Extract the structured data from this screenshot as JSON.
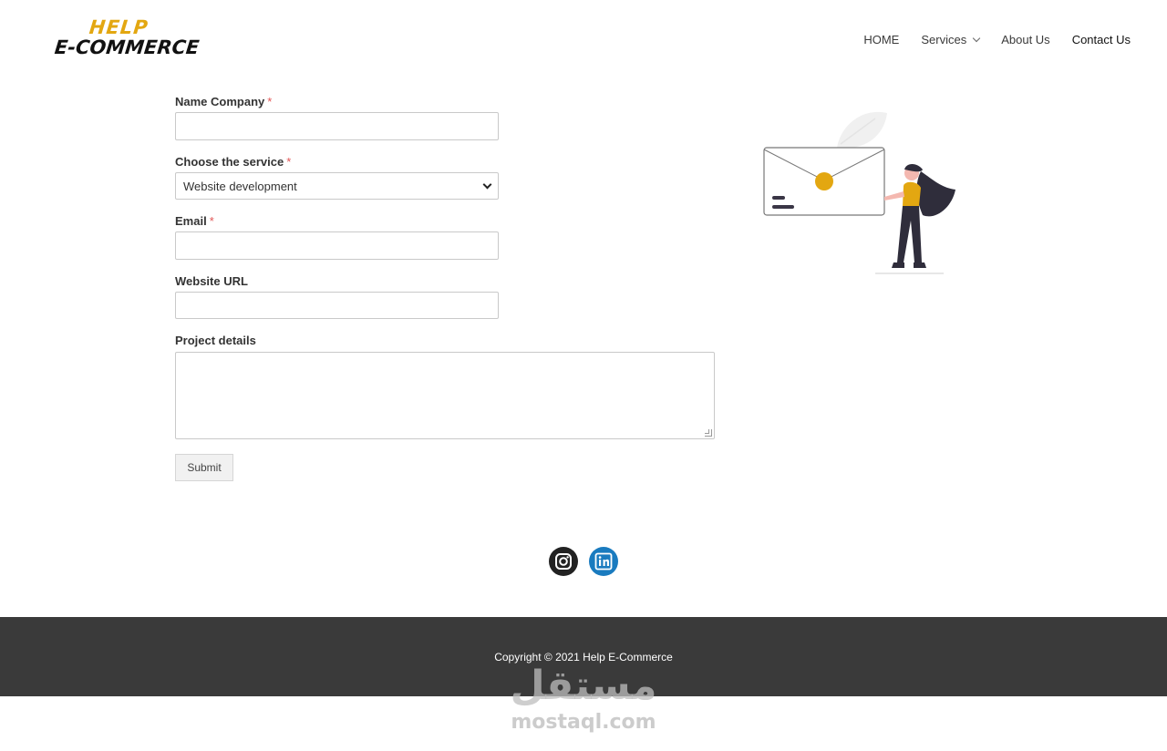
{
  "brand": {
    "line1": "HELP",
    "line2": "E-COMMERCE",
    "accent_color": "#e3a711"
  },
  "nav": {
    "items": [
      {
        "label": "HOME"
      },
      {
        "label": "Services",
        "has_dropdown": true
      },
      {
        "label": "About Us"
      },
      {
        "label": "Contact Us"
      }
    ]
  },
  "form": {
    "company": {
      "label": "Name Company",
      "required_mark": "*",
      "value": ""
    },
    "service": {
      "label": "Choose the service",
      "required_mark": "*",
      "value": "Website development"
    },
    "email": {
      "label": "Email",
      "required_mark": "*",
      "value": ""
    },
    "website": {
      "label": "Website URL",
      "value": ""
    },
    "details": {
      "label": "Project details",
      "value": ""
    },
    "submit_label": "Submit"
  },
  "illustration": {
    "icon": "envelope-woman-illustration"
  },
  "social": [
    {
      "icon": "instagram-icon"
    },
    {
      "icon": "linkedin-icon"
    }
  ],
  "footer": {
    "copyright": "Copyright © 2021 Help E-Commerce",
    "background": "#3a3a3a"
  },
  "watermark": {
    "arabic": "مستقل",
    "latin": "mostaql.com"
  }
}
